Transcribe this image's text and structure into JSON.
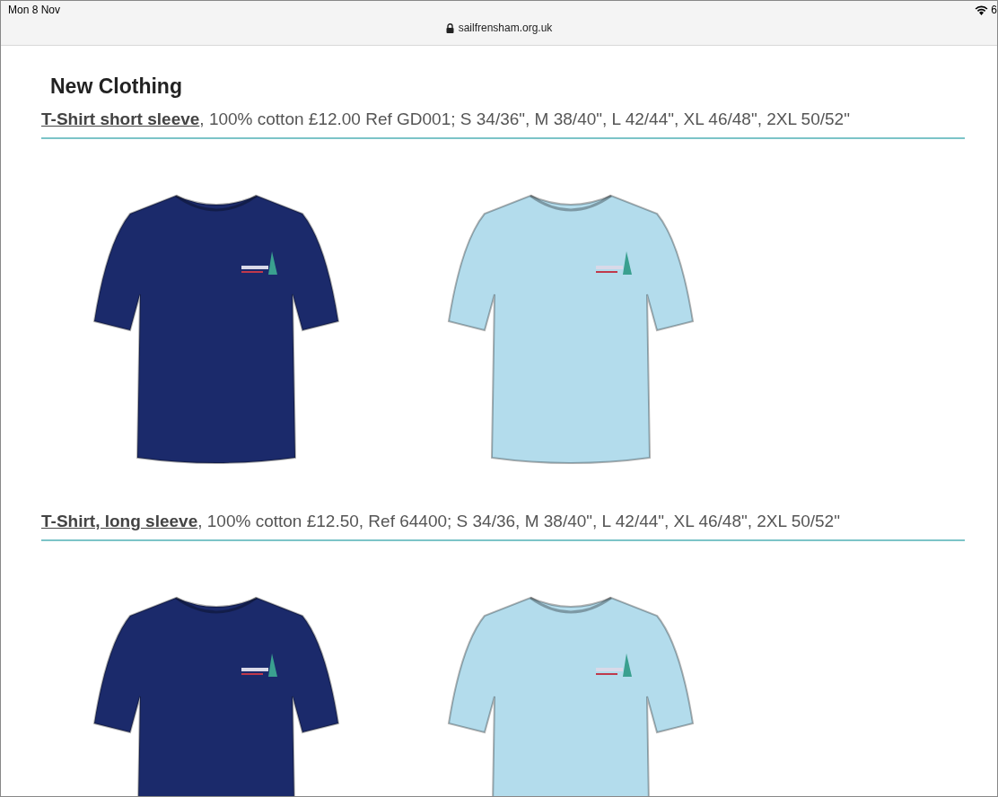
{
  "status_bar": {
    "time": "Mon 8 Nov",
    "battery": "6"
  },
  "address_bar": {
    "url": "sailfrensham.org.uk"
  },
  "page": {
    "heading": "New Clothing",
    "products": [
      {
        "link": "T-Shirt short sleeve",
        "description": ", 100% cotton £12.00 Ref GD001;   S 34/36\", M 38/40\", L 42/44\", XL 46/48\", 2XL 50/52\"",
        "images": [
          {
            "color": "#1b2a6b"
          },
          {
            "color": "#b3dcec"
          }
        ]
      },
      {
        "link": "T-Shirt, long sleeve",
        "description": ", 100% cotton £12.50, Ref 64400;  S 34/36, M 38/40\", L 42/44\", XL 46/48\", 2XL 50/52\"",
        "images": [
          {
            "color": "#1b2a6b"
          },
          {
            "color": "#b3dcec"
          }
        ]
      }
    ]
  }
}
